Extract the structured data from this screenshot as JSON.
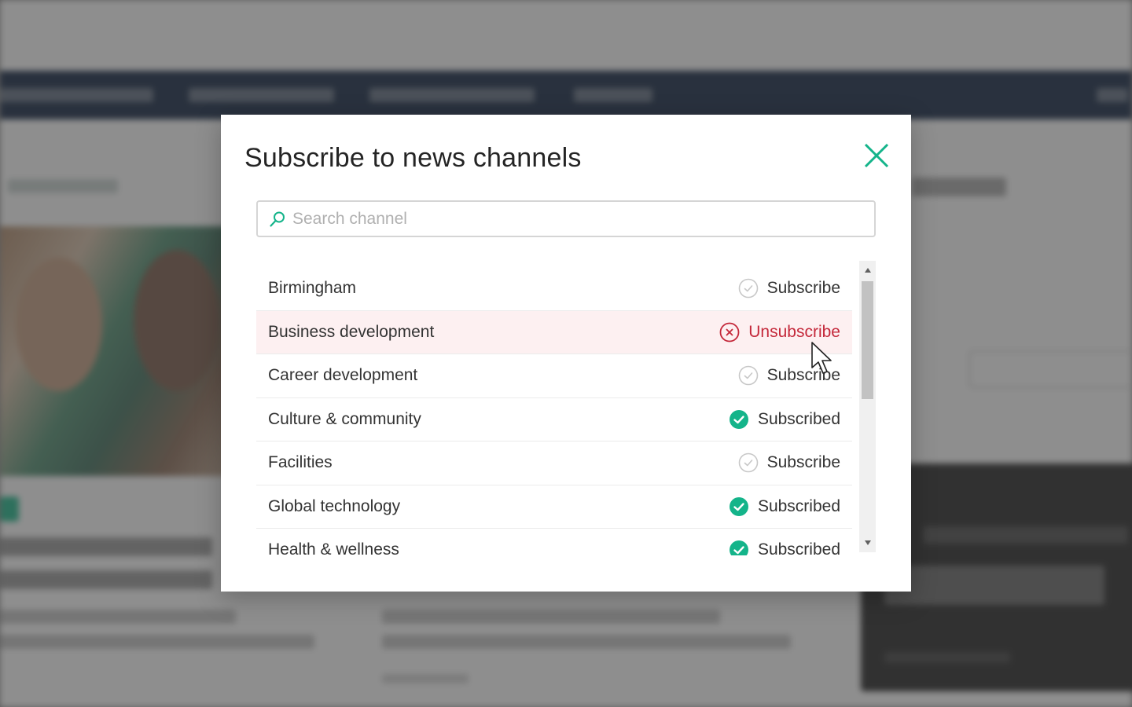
{
  "modal": {
    "title": "Subscribe to news channels",
    "close_icon": "close-icon"
  },
  "search": {
    "placeholder": "Search channel",
    "value": "",
    "icon": "search-icon"
  },
  "channels": [
    {
      "name": "Birmingham",
      "status": "Subscribe",
      "state": "unsubscribed"
    },
    {
      "name": "Business development",
      "status": "Unsubscribe",
      "state": "hover-unsubscribe"
    },
    {
      "name": "Career development",
      "status": "Subscribe",
      "state": "unsubscribed"
    },
    {
      "name": "Culture & community",
      "status": "Subscribed",
      "state": "subscribed"
    },
    {
      "name": "Facilities",
      "status": "Subscribe",
      "state": "unsubscribed"
    },
    {
      "name": "Global technology",
      "status": "Subscribed",
      "state": "subscribed"
    },
    {
      "name": "Health & wellness",
      "status": "Subscribed",
      "state": "subscribed"
    }
  ],
  "colors": {
    "accent": "#14b48a",
    "danger": "#c4283a",
    "hover_row": "#fdf0f1",
    "topbar": "#0f2240"
  }
}
